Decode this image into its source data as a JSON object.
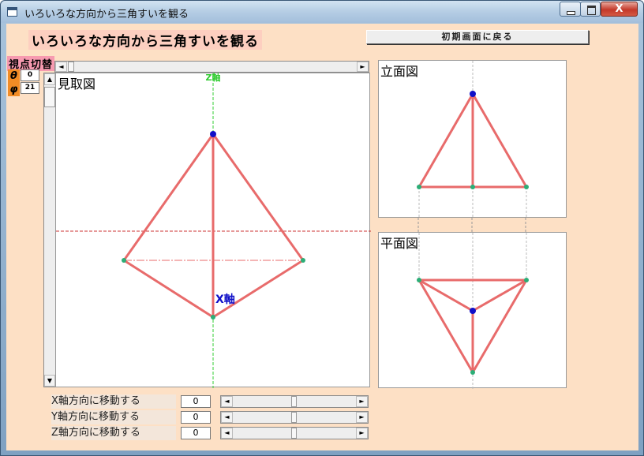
{
  "window": {
    "title": "いろいろな方向から三角すいを観る",
    "close_glyph": "X"
  },
  "app": {
    "heading": "いろいろな方向から三角すいを観る",
    "reset_button": "初期画面に戻る"
  },
  "viewpoint": {
    "label": "視点切替",
    "theta_label": "θ",
    "theta_value": "0",
    "phi_label": "φ",
    "phi_value": "21"
  },
  "views": {
    "perspective_title": "見取図",
    "z_axis_label": "Z軸",
    "x_axis_label": "X軸",
    "elevation_title": "立面図",
    "plan_title": "平面図"
  },
  "scroll_arrows": {
    "left": "◄",
    "right": "►",
    "up": "▲",
    "down": "▼"
  },
  "move_controls": [
    {
      "label": "X軸方向に移動する",
      "value": "0"
    },
    {
      "label": "Y軸方向に移動する",
      "value": "0"
    },
    {
      "label": "Z軸方向に移動する",
      "value": "0"
    }
  ],
  "colors": {
    "edge": "#e86b6b",
    "vertex_top": "#1010c8",
    "vertex_base": "#2cae77",
    "axis_z": "#33cc33",
    "axis_x": "#cc3333",
    "background": "#fde0c5"
  }
}
